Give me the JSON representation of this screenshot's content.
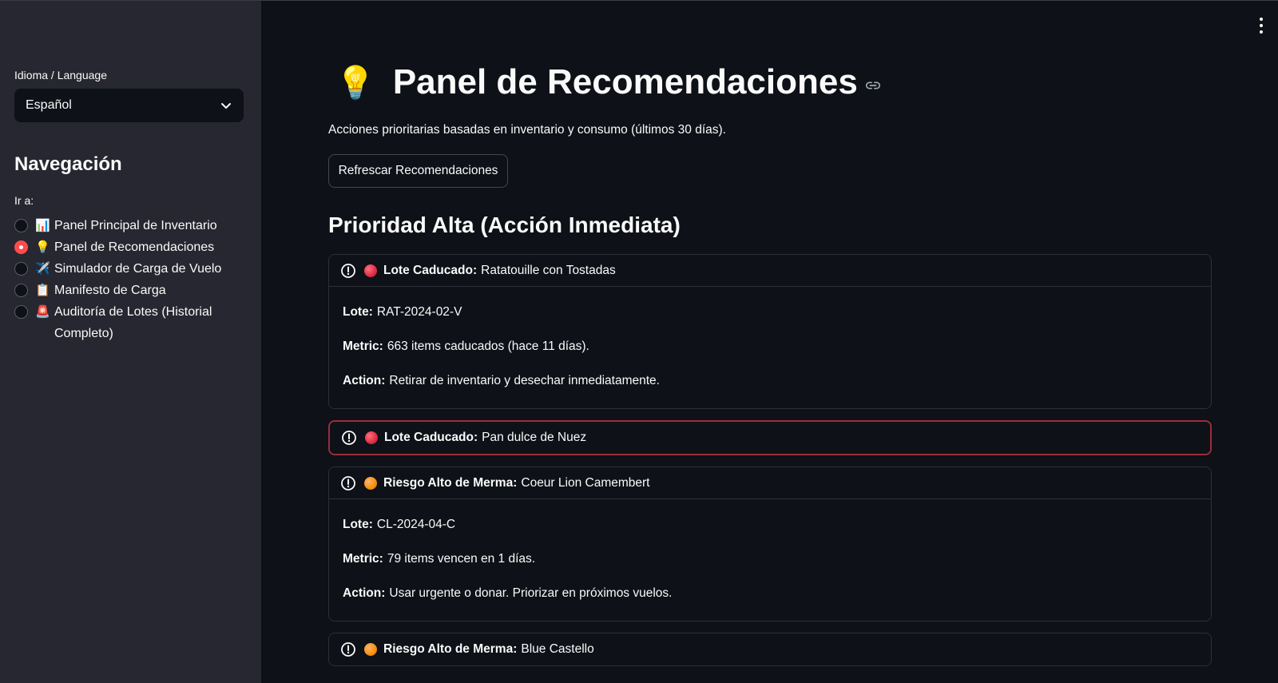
{
  "sidebar": {
    "language_label": "Idioma / Language",
    "language_value": "Español",
    "nav_title": "Navegación",
    "nav_sub": "Ir a:",
    "items": [
      {
        "emoji": "📊",
        "label": "Panel Principal de Inventario",
        "selected": false
      },
      {
        "emoji": "💡",
        "label": "Panel de Recomendaciones",
        "selected": true
      },
      {
        "emoji": "✈️",
        "label": "Simulador de Carga de Vuelo",
        "selected": false
      },
      {
        "emoji": "📋",
        "label": "Manifesto de Carga",
        "selected": false
      },
      {
        "emoji": "🚨",
        "label": "Auditoría de Lotes (Historial Completo)",
        "selected": false
      }
    ]
  },
  "main": {
    "title_emoji": "💡",
    "title": "Panel de Recomendaciones",
    "caption": "Acciones prioritarias basadas en inventario y consumo (últimos 30 días).",
    "refresh_label": "Refrescar Recomendaciones",
    "section_title": "Prioridad Alta (Acción Inmediata)",
    "recommendations": [
      {
        "severity": "red",
        "type_label": "Lote Caducado:",
        "product": "Ratatouille con Tostadas",
        "expanded": true,
        "lote_label": "Lote:",
        "lote": "RAT-2024-02-V",
        "metric_label": "Metric:",
        "metric": "663 items caducados (hace 11 días).",
        "action_label": "Action:",
        "action": "Retirar de inventario y desechar inmediatamente."
      },
      {
        "severity": "red",
        "type_label": "Lote Caducado:",
        "product": "Pan dulce de Nuez",
        "expanded": false
      },
      {
        "severity": "orange",
        "type_label": "Riesgo Alto de Merma:",
        "product": "Coeur Lion Camembert",
        "expanded": true,
        "lote_label": "Lote:",
        "lote": "CL-2024-04-C",
        "metric_label": "Metric:",
        "metric": "79 items vencen en 1 días.",
        "action_label": "Action:",
        "action": "Usar urgente o donar. Priorizar en próximos vuelos."
      },
      {
        "severity": "orange",
        "type_label": "Riesgo Alto de Merma:",
        "product": "Blue Castello",
        "expanded": false
      }
    ]
  },
  "colors": {
    "background": "#0e1117",
    "sidebar": "#262730",
    "accent": "#ff4b4b",
    "focus_border": "#9b2e3a"
  },
  "icons": [
    "chevron-down-icon",
    "link-icon",
    "alert-circle-icon",
    "kebab-menu-icon"
  ]
}
